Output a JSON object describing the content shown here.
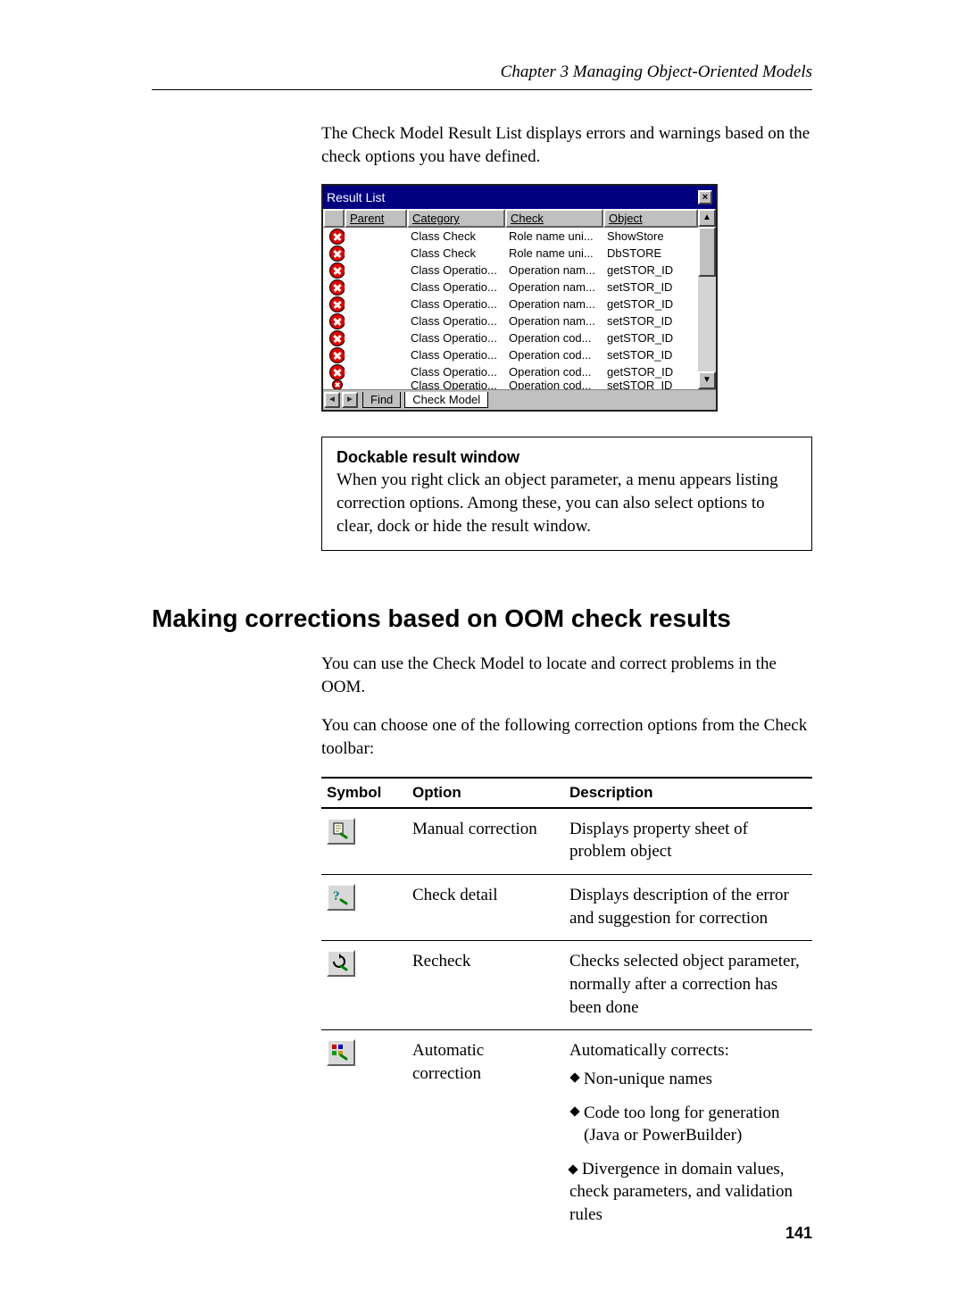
{
  "header": {
    "running_head": "Chapter 3    Managing Object-Oriented Models"
  },
  "intro_para": "The Check Model Result List displays errors and warnings based on the check options you have defined.",
  "result_list": {
    "title": "Result List",
    "columns": {
      "parent": "Parent",
      "category": "Category",
      "check": "Check",
      "object": "Object"
    },
    "rows": [
      {
        "parent": "",
        "category": "Class Check",
        "check": "Role name uni...",
        "object": "ShowStore"
      },
      {
        "parent": "",
        "category": "Class Check",
        "check": "Role name uni...",
        "object": "DbSTORE"
      },
      {
        "parent": "",
        "category": "Class Operatio...",
        "check": "Operation nam...",
        "object": "getSTOR_ID"
      },
      {
        "parent": "",
        "category": "Class Operatio...",
        "check": "Operation nam...",
        "object": "setSTOR_ID"
      },
      {
        "parent": "",
        "category": "Class Operatio...",
        "check": "Operation nam...",
        "object": "getSTOR_ID"
      },
      {
        "parent": "",
        "category": "Class Operatio...",
        "check": "Operation nam...",
        "object": "setSTOR_ID"
      },
      {
        "parent": "",
        "category": "Class Operatio...",
        "check": "Operation cod...",
        "object": "getSTOR_ID"
      },
      {
        "parent": "",
        "category": "Class Operatio...",
        "check": "Operation cod...",
        "object": "setSTOR_ID"
      },
      {
        "parent": "",
        "category": "Class Operatio...",
        "check": "Operation cod...",
        "object": "getSTOR_ID"
      }
    ],
    "cut_row": {
      "category": "Class Operatio...",
      "check": "Operation cod...",
      "object": "setSTOR_ID"
    },
    "tabs": {
      "find": "Find",
      "check_model": "Check Model"
    }
  },
  "note": {
    "title": "Dockable result window",
    "body": "When you right click an object parameter, a menu appears listing correction options. Among these, you can also select options to clear, dock or hide the result window."
  },
  "section_heading": "Making corrections based on OOM check results",
  "para2": "You can use the Check Model to locate and correct problems in the OOM.",
  "para3": "You can choose one of the following correction options from the Check toolbar:",
  "options_table": {
    "headers": {
      "symbol": "Symbol",
      "option": "Option",
      "description": "Description"
    },
    "rows": [
      {
        "option": "Manual correction",
        "description": "Displays property sheet of problem object"
      },
      {
        "option": "Check detail",
        "description": "Displays description of the error and suggestion for correction"
      },
      {
        "option": "Recheck",
        "description": "Checks selected object parameter, normally after a correction has been done"
      },
      {
        "option": "Automatic correction",
        "auto_intro": "Automatically corrects:",
        "bullets": [
          "Non-unique names",
          "Code too long for generation (Java or PowerBuilder)"
        ],
        "tail": "Divergence in domain values, check parameters, and validation rules"
      }
    ]
  },
  "page_number": "141"
}
